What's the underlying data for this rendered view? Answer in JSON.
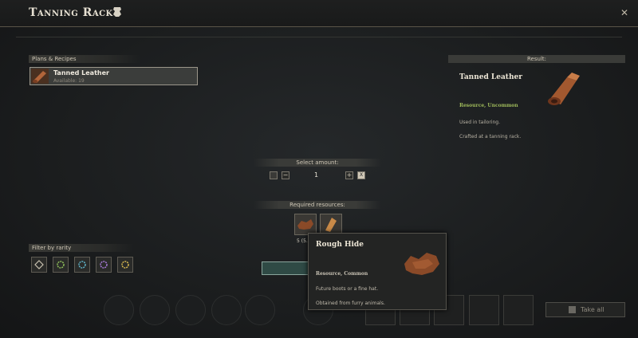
{
  "header": {
    "title": "Tanning Rack",
    "close": "✕"
  },
  "recipes": {
    "section_label": "Plans & Recipes",
    "items": [
      {
        "name": "Tanned Leather",
        "available": "Available: 19"
      }
    ]
  },
  "result": {
    "section_label": "Result:",
    "name": "Tanned Leather",
    "rarity": "Resource, Uncommon",
    "description": [
      "Used in tailoring.",
      "Crafted at a tanning rack."
    ]
  },
  "amount": {
    "section_label": "Select amount:",
    "value": "1",
    "decrement": "−",
    "increment": "+",
    "max_key": "X"
  },
  "required": {
    "section_label": "Required resources:",
    "count_label": "5 (5..."
  },
  "rarity_filter": {
    "section_label": "Filter by rarity",
    "colors": [
      "#c9c2b0",
      "#8fbf5a",
      "#5fb3c8",
      "#a77ad8",
      "#d8b850"
    ]
  },
  "take_all": {
    "label": "Take all"
  },
  "tooltip": {
    "name": "Rough Hide",
    "rarity": "Resource, Common",
    "description": [
      "Future boots or a fine hat.",
      "Obtained from furry animals."
    ]
  }
}
